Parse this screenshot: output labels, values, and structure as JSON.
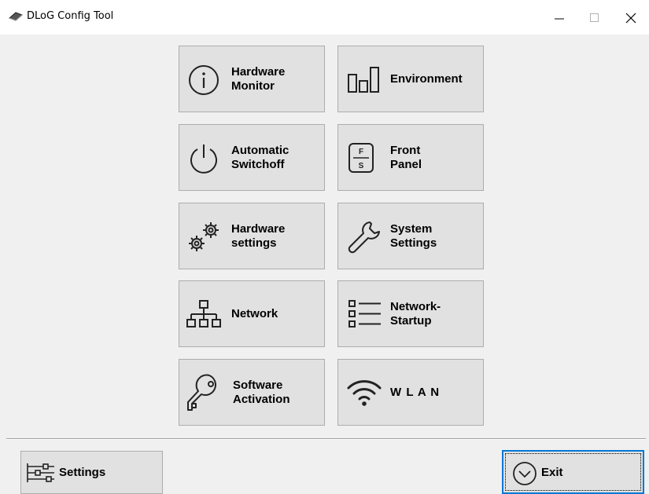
{
  "window": {
    "title": "DLoG Config Tool"
  },
  "buttons": [
    {
      "id": "hardware-monitor",
      "line1": "Hardware",
      "line2": "Monitor",
      "icon": "info-circle-icon"
    },
    {
      "id": "environment",
      "line1": "Environment",
      "line2": "",
      "icon": "bar-chart-icon"
    },
    {
      "id": "automatic-switchoff",
      "line1": "Automatic",
      "line2": "Switchoff",
      "icon": "power-icon"
    },
    {
      "id": "front-panel",
      "line1": "Front",
      "line2": "Panel",
      "icon": "front-panel-icon",
      "icon_text_top": "F",
      "icon_text_bottom": "S"
    },
    {
      "id": "hardware-settings",
      "line1": "Hardware",
      "line2": "settings",
      "icon": "gears-icon"
    },
    {
      "id": "system-settings",
      "line1": "System",
      "line2": "Settings",
      "icon": "wrench-icon"
    },
    {
      "id": "network",
      "line1": "Network",
      "line2": "",
      "icon": "network-icon"
    },
    {
      "id": "network-startup",
      "line1": "Network-",
      "line2": "Startup",
      "icon": "list-icon"
    },
    {
      "id": "software-activation",
      "line1": "Software",
      "line2": "Activation",
      "icon": "key-icon"
    },
    {
      "id": "wlan",
      "line1": "W L A N",
      "line2": "",
      "icon": "wifi-icon"
    }
  ],
  "footer": {
    "settings_label": "Settings",
    "exit_label": "Exit"
  },
  "colors": {
    "focus_border": "#0078d7",
    "button_bg": "#e1e1e1",
    "window_bg": "#f0f0f0"
  }
}
